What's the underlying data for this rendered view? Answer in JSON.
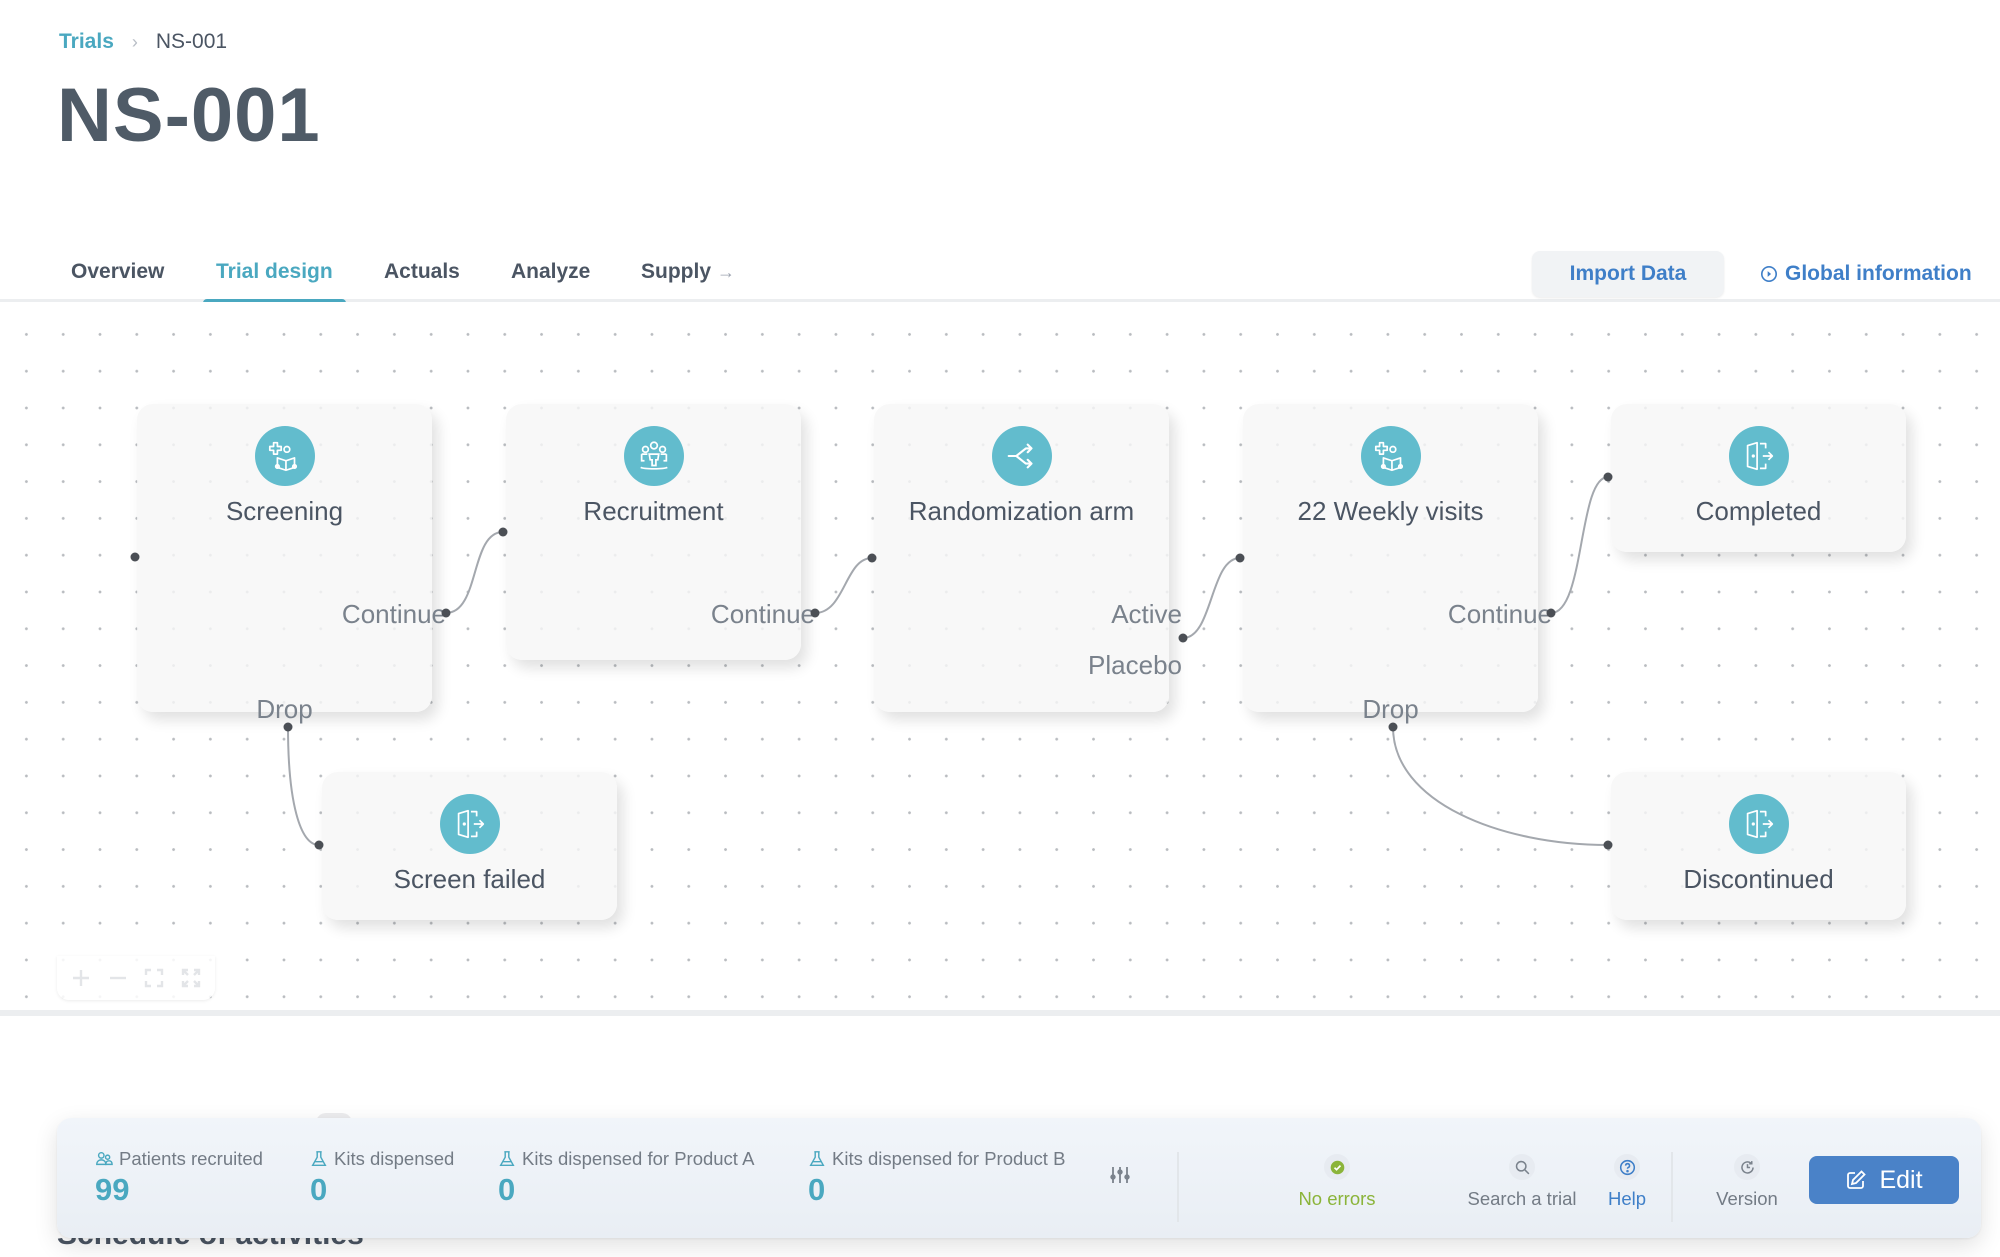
{
  "breadcrumb": {
    "parent": "Trials",
    "separator": "›",
    "current": "NS-001"
  },
  "page_title": "NS-001",
  "tabs": [
    {
      "label": "Overview",
      "active": false
    },
    {
      "label": "Trial design",
      "active": true
    },
    {
      "label": "Actuals",
      "active": false
    },
    {
      "label": "Analyze",
      "active": false
    },
    {
      "label": "Supply",
      "active": false,
      "external_arrow": "→"
    }
  ],
  "header_actions": {
    "import_label": "Import Data",
    "global_info_label": "Global information",
    "global_info_icon": "play-circle-icon"
  },
  "flow": {
    "accent": "#62bccd",
    "nodes": [
      {
        "id": "screening",
        "label": "Screening",
        "icon": "screening-icon",
        "outputs": [
          "Continue",
          "Drop"
        ]
      },
      {
        "id": "recruitment",
        "label": "Recruitment",
        "icon": "group-icon",
        "outputs": [
          "Continue"
        ]
      },
      {
        "id": "randomization",
        "label": "Randomization arm",
        "icon": "split-arrows-icon",
        "outputs": [
          "Active",
          "Placebo"
        ]
      },
      {
        "id": "weekly",
        "label": "22 Weekly visits",
        "icon": "screening-icon",
        "outputs": [
          "Continue",
          "Drop"
        ]
      },
      {
        "id": "completed",
        "label": "Completed",
        "icon": "exit-door-icon",
        "outputs": []
      },
      {
        "id": "screen_failed",
        "label": "Screen failed",
        "icon": "exit-door-icon",
        "outputs": []
      },
      {
        "id": "discontinued",
        "label": "Discontinued",
        "icon": "exit-door-icon",
        "outputs": []
      }
    ],
    "edges": [
      {
        "from": "screening",
        "port": "Continue",
        "to": "recruitment"
      },
      {
        "from": "screening",
        "port": "Drop",
        "to": "screen_failed"
      },
      {
        "from": "recruitment",
        "port": "Continue",
        "to": "randomization"
      },
      {
        "from": "randomization",
        "port": "Active/Placebo",
        "to": "weekly"
      },
      {
        "from": "weekly",
        "port": "Continue",
        "to": "completed"
      },
      {
        "from": "weekly",
        "port": "Drop",
        "to": "discontinued"
      }
    ]
  },
  "zoom_controls": [
    "zoom-in",
    "zoom-out",
    "fit-view",
    "fullscreen"
  ],
  "behind_section_title": "Schedule of activities",
  "bottom_bar": {
    "stats": [
      {
        "label": "Patients recruited",
        "value": "99",
        "icon": "users-icon"
      },
      {
        "label": "Kits dispensed",
        "value": "0",
        "icon": "flask-icon"
      },
      {
        "label": "Kits dispensed for Product A",
        "value": "0",
        "icon": "flask-icon"
      },
      {
        "label": "Kits dispensed for Product B",
        "value": "0",
        "icon": "flask-icon"
      }
    ],
    "status_label": "No errors",
    "status_color": "#8bb43a",
    "search_label": "Search a trial",
    "help_label": "Help",
    "version_label": "Version",
    "edit_label": "Edit"
  }
}
